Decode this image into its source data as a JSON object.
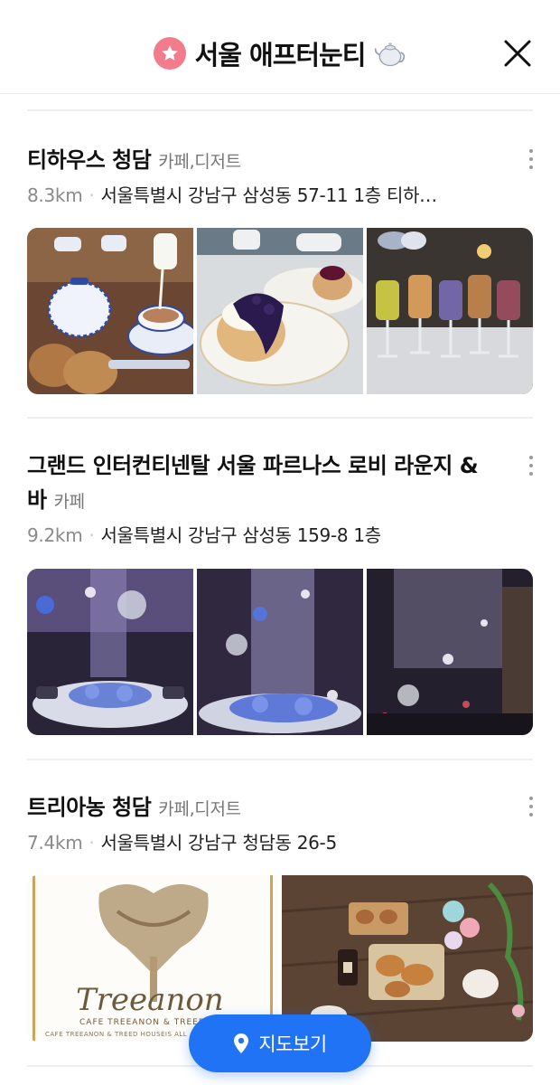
{
  "header": {
    "title": "서울 애프터눈티",
    "close_icon": "close-icon",
    "badge_icon": "star-icon",
    "title_emoji_icon": "teapot-icon"
  },
  "places": [
    {
      "name": "티하우스 청담",
      "category": "카페,디저트",
      "distance": "8.3km",
      "address": "서울특별시 강남구 삼성동 57-11 1층 티하…",
      "photos": [
        "teapot-and-scones-photo",
        "scone-with-blueberry-jam-photo",
        "colorful-tea-drinks-photo"
      ]
    },
    {
      "name": "그랜드 인터컨티넨탈 서울 파르나스 로비 라운지 & 바",
      "category": "카페",
      "distance": "9.2km",
      "address": "서울특별시 강남구 삼성동 159-8 1층",
      "photos": [
        "lobby-lounge-installation-photo",
        "lobby-hydrangea-display-photo",
        "lobby-crystal-ceiling-photo"
      ]
    },
    {
      "name": "트리아농 청담",
      "category": "카페,디저트",
      "distance": "7.4km",
      "address": "서울특별시 강남구 청담동 26-5",
      "photos": [
        "treeanon-logo-card-photo",
        "pastries-on-wooden-table-photo"
      ],
      "logo_text": "Treeanon",
      "logo_subtext": "CAFE TREEANON & TREED",
      "logo_footer": "CAFE TREEANON & TREED HOUSEIS ALL AB"
    }
  ],
  "map_button": {
    "label": "지도보기",
    "icon": "location-pin-icon"
  },
  "colors": {
    "accent": "#2173f5",
    "badge": "#f27b8c",
    "muted_text": "#777777"
  }
}
